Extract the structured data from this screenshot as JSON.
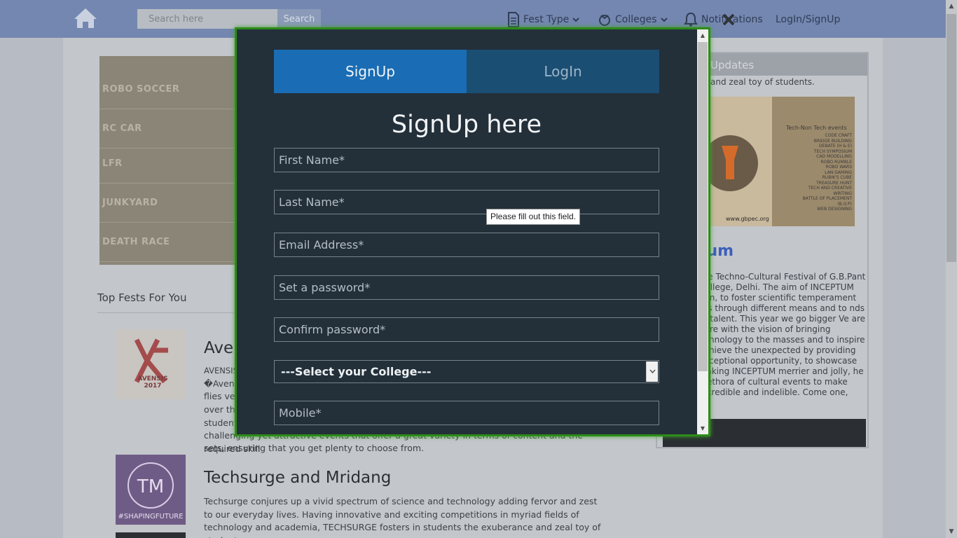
{
  "nav": {
    "search_placeholder": "Search here",
    "search_label": "Search",
    "fest_type": "Fest Type",
    "colleges": "Colleges",
    "notifications": "Notifications",
    "login_signup": "LogIn/SignUp"
  },
  "slider": {
    "rows": [
      "ROBO SOCCER",
      "RC CAR",
      "LFR",
      "JUNKYARD",
      "DEATH RACE"
    ]
  },
  "top_fests": {
    "title": "Top Fests For You",
    "items": [
      {
        "title": "Aven",
        "text_lines": [
          "AVENSIS",
          "�Avens",
          "flies ve",
          "over th",
          "student",
          "challenging yet attractive events that offer a great variety in terms of content and the required skill",
          "sets, ensuring that you get plenty to choose from."
        ]
      },
      {
        "title": "Techsurge and Mridang",
        "text": "Techsurge conjures up a vivid spectrum of science and technology adding fervor and zest to our everyday lives. Having innovative and exciting competitions in myriad fields of technology and academia, TECHSURGE fosters in students the exuberance and zeal toy of students."
      }
    ],
    "thumb1_text": "AVENSIS 2017",
    "thumb2_text": "#SHAPINGFUTURE"
  },
  "updates": {
    "header": "Updates",
    "line": "and zeal toy of students.",
    "poster_heading": "Tech-Non Tech events",
    "poster_events": [
      "CODE CRAFT",
      "BRIDGE BUILDING",
      "DEBATE (H & E)",
      "TECH SYMPOSIUM",
      "CAD MODELLING",
      "ROBO RUMBLE",
      "ROBO WARS",
      "LAN GAMING",
      "RUBIK'S CUBE",
      "TREASURE HUNT",
      "TECH AND CREATIVE WRITING",
      "BATTLE OF PLACEMENT (B.O.P)",
      "WEB DESIGNING"
    ],
    "poster_url": "www.gbpec.org",
    "title": "tum",
    "text": "the Techno-Cultural Festival of G.B.Pant College, Delhi. The aim of INCEPTUM een, to foster scientific temperament nts through different means and to nds of talent. This year we go bigger Ve are here with the vision of bringing echnology to the masses and to inspire achieve the unexpected by providing exceptional opportunity, to showcase Making INCEPTUM merrier and jolly, he plethora of cultural events to make incredible and indelible. Come one,"
  },
  "modal": {
    "tab_signup": "SignUp",
    "tab_login": "LogIn",
    "title": "SignUp here",
    "first_name": "First Name*",
    "last_name": "Last Name*",
    "email": "Email Address*",
    "password": "Set a password*",
    "confirm_password": "Confirm password*",
    "college_select": "---Select your College---",
    "mobile": "Mobile*",
    "tooltip": "Please fill out this field."
  },
  "colors": {
    "nav_bg": "#7487b0",
    "modal_bg": "#23303a",
    "modal_border": "#2e8b1a",
    "tab_active": "#1a6db4",
    "tab_inactive": "#1b4e73"
  }
}
